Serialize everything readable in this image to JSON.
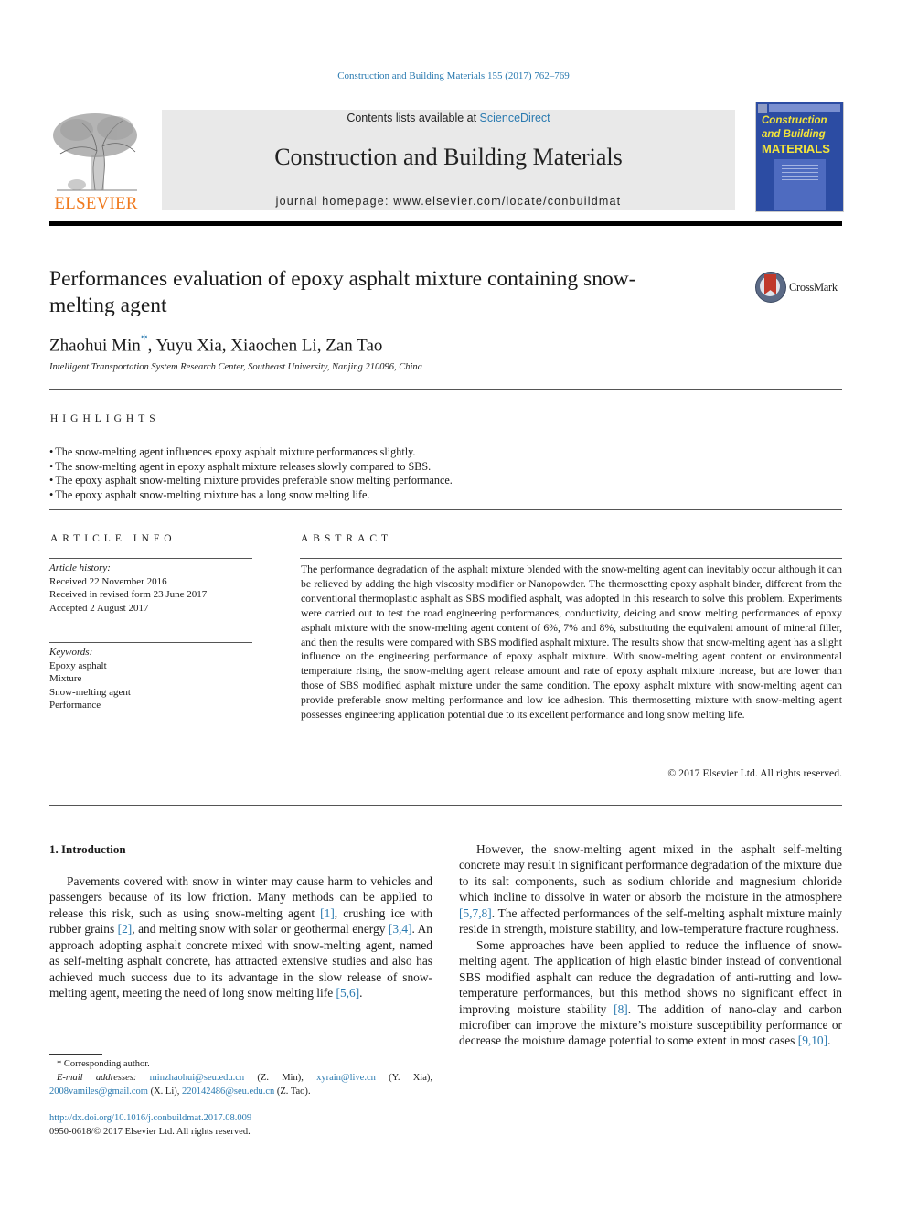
{
  "citation": "Construction and Building Materials 155 (2017) 762–769",
  "header": {
    "publisher_logo_text": "ELSEVIER",
    "contents_prefix": "Contents lists available at ",
    "contents_link": "ScienceDirect",
    "journal_title": "Construction and Building Materials",
    "homepage": "journal homepage: www.elsevier.com/locate/conbuildmat",
    "cover": {
      "line1": "Construction",
      "line2": "and Building",
      "line3": "MATERIALS",
      "bg_color": "#2c4ca3",
      "text_color": "#f3e43a"
    },
    "brand_color": "#f07a1e",
    "link_color": "#2a7ab0"
  },
  "article": {
    "title": "Performances evaluation of epoxy asphalt mixture containing snow-melting agent",
    "crossmark_label": "CrossMark",
    "authors": [
      {
        "name": "Zhaohui Min",
        "corresponding_mark": "*"
      },
      {
        "name": "Yuyu Xia"
      },
      {
        "name": "Xiaochen Li"
      },
      {
        "name": "Zan Tao"
      }
    ],
    "affiliation": "Intelligent Transportation System Research Center, Southeast University, Nanjing 210096, China"
  },
  "highlights": {
    "heading": "HIGHLIGHTS",
    "items": [
      "The snow-melting agent influences epoxy asphalt mixture performances slightly.",
      "The snow-melting agent in epoxy asphalt mixture releases slowly compared to SBS.",
      "The epoxy asphalt snow-melting mixture provides preferable snow melting performance.",
      "The epoxy asphalt snow-melting mixture has a long snow melting life."
    ]
  },
  "article_info": {
    "heading": "ARTICLE INFO",
    "history_label": "Article history:",
    "history": [
      "Received 22 November 2016",
      "Received in revised form 23 June 2017",
      "Accepted 2 August 2017"
    ],
    "keywords_label": "Keywords:",
    "keywords": [
      "Epoxy asphalt",
      "Mixture",
      "Snow-melting agent",
      "Performance"
    ]
  },
  "abstract": {
    "heading": "ABSTRACT",
    "text": "The performance degradation of the asphalt mixture blended with the snow-melting agent can inevitably occur although it can be relieved by adding the high viscosity modifier or Nanopowder. The thermoset­ting epoxy asphalt binder, different from the conventional thermoplastic asphalt as SBS modified asphalt, was adopted in this research to solve this problem. Experiments were carried out to test the road engi­neering performances, conductivity, deicing and snow melting performances of epoxy asphalt mixture with the snow-melting agent content of 6%, 7% and 8%, substituting the equivalent amount of mineral filler, and then the results were compared with SBS modified asphalt mixture. The results show that snow-melting agent has a slight influence on the engineering performance of epoxy asphalt mixture. With snow-melting agent content or environmental temperature rising, the snow-melting agent release amount and rate of epoxy asphalt mixture increase, but are lower than those of SBS modified asphalt mixture under the same condition. The epoxy asphalt mixture with snow-melting agent can provide preferable snow melting performance and low ice adhesion. This thermosetting mixture with snow-melting agent possesses engineering application potential due to its excellent performance and long snow melting life.",
    "copyright": "© 2017 Elsevier Ltd. All rights reserved."
  },
  "body": {
    "section_heading": "1. Introduction",
    "left_paragraph": [
      {
        "t": "Pavements covered with snow in winter may cause harm to vehicles and passengers because of its low friction. Many methods can be applied to release this risk, such as using snow-melting agent "
      },
      {
        "ref": "[1]"
      },
      {
        "t": ", crushing ice with rubber grains "
      },
      {
        "ref": "[2]"
      },
      {
        "t": ", and melting snow with solar or geothermal energy "
      },
      {
        "ref": "[3,4]"
      },
      {
        "t": ". An approach adopting asphalt concrete mixed with snow-melting agent, named as self-melting asphalt concrete, has attracted extensive studies and also has achieved much success due to its advantage in the slow release of snow-melting agent, meeting the need of long snow melting life "
      },
      {
        "ref": "[5,6]"
      },
      {
        "t": "."
      }
    ],
    "right_paragraphs": [
      [
        {
          "t": "However, the snow-melting agent mixed in the asphalt self-melting concrete may result in significant performance degrada­tion of the mixture due to its salt components, such as sodium chloride and magnesium chloride which incline to dissolve in water or absorb the moisture in the atmosphere "
        },
        {
          "ref": "[5,7,8]"
        },
        {
          "t": ". The affected performances of the self-melting asphalt mixture mainly reside in strength, moisture stability, and low-temperature frac­ture roughness."
        }
      ],
      [
        {
          "t": "Some approaches have been applied to reduce the influence of snow-melting agent. The application of high elastic binder instead of conventional SBS modified asphalt can reduce the degradation of anti-rutting and low-temperature performances, but this method shows no significant effect in improving moisture stability "
        },
        {
          "ref": "[8]"
        },
        {
          "t": ". The addition of nano-clay and carbon microfiber can improve the mixture’s moisture susceptibility performance or decrease the moisture damage potential to some extent in most cases "
        },
        {
          "ref": "[9,10]"
        },
        {
          "t": "."
        }
      ]
    ]
  },
  "footnotes": {
    "corresponding": "* Corresponding author.",
    "email_label": "E-mail addresses:",
    "emails": [
      {
        "address": "minzhaohui@seu.edu.cn",
        "who": "(Z. Min)"
      },
      {
        "address": "xyrain@live.cn",
        "who": "(Y. Xia)"
      },
      {
        "address": "2008vamiles@gmail.com",
        "who": "(X. Li)"
      },
      {
        "address": "220142486@seu.edu.cn",
        "who": "(Z. Tao)"
      }
    ],
    "doi": "http://dx.doi.org/10.1016/j.conbuildmat.2017.08.009",
    "issn_line": "0950-0618/© 2017 Elsevier Ltd. All rights reserved."
  }
}
